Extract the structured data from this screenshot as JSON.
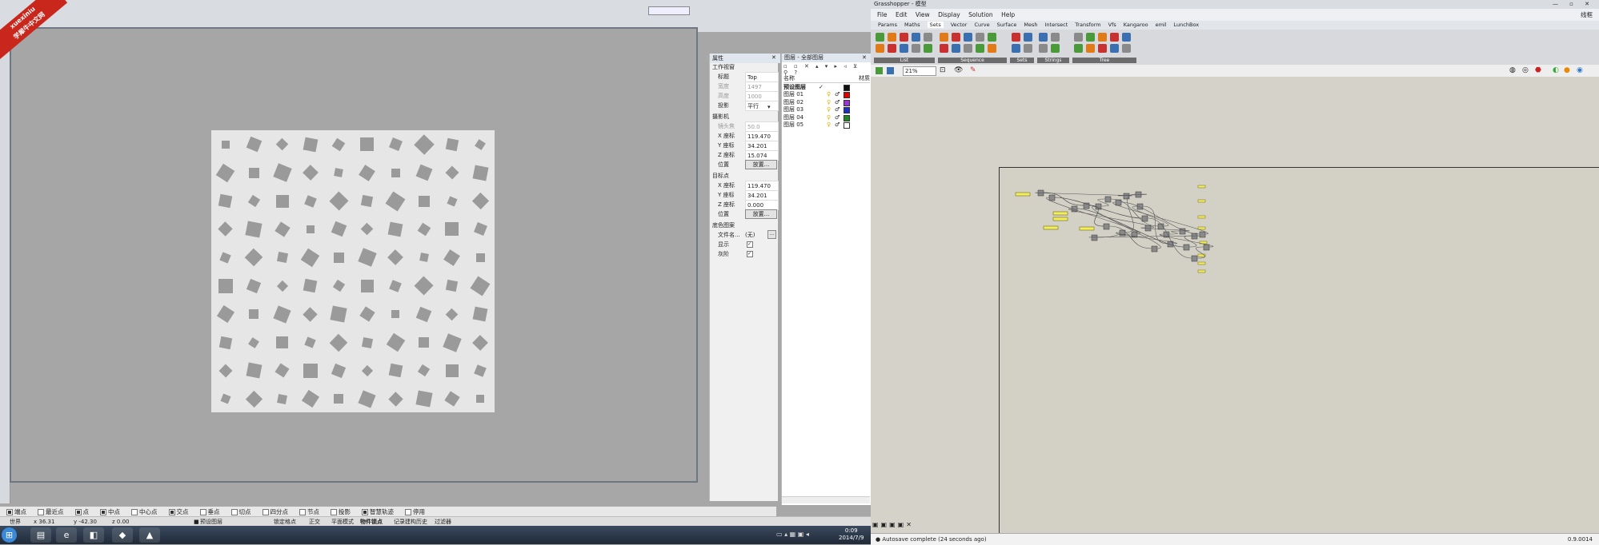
{
  "rhino": {
    "title": "",
    "subtitle": "",
    "menu": [
      "",
      ""
    ],
    "viewport_bg": "#a6a6a6"
  },
  "properties": {
    "header": "属性",
    "section_view": "工作视窗",
    "title_label": "标题",
    "title_value": "Top",
    "width_label": "宽度",
    "width_value": "1497",
    "height_label": "高度",
    "height_value": "1000",
    "projection_label": "投影",
    "projection_value": "平行",
    "section_camera": "摄影机",
    "lens_label": "镜头焦",
    "lens_value": "50.0",
    "cam_x_label": "X 座标",
    "cam_x_value": "119.470",
    "cam_y_label": "Y 座标",
    "cam_y_value": "34.201",
    "cam_z_label": "Z 座标",
    "cam_z_value": "15.074",
    "cam_pos_label": "位置",
    "place_button": "放置...",
    "section_target": "目标点",
    "tgt_x_label": "X 座标",
    "tgt_x_value": "119.470",
    "tgt_y_label": "Y 座标",
    "tgt_y_value": "34.201",
    "tgt_z_label": "Z 座标",
    "tgt_z_value": "0.000",
    "tgt_pos_label": "位置",
    "place_button2": "放置...",
    "section_bg": "底色图案",
    "file_label": "文件名...",
    "file_value": "(无)",
    "show_label": "显示",
    "gray_label": "灰阶"
  },
  "layers": {
    "header": "图层 - 全部图层",
    "col_name": "名称",
    "col_material": "材质",
    "rows": [
      {
        "name": "预设图层",
        "color": "#111111"
      },
      {
        "name": "图层 01",
        "color": "#e00000"
      },
      {
        "name": "图层 02",
        "color": "#9b35d6"
      },
      {
        "name": "图层 03",
        "color": "#1e2fd0"
      },
      {
        "name": "图层 04",
        "color": "#1d8a1d"
      },
      {
        "name": "图层 05",
        "color": "#ffffff"
      }
    ]
  },
  "osnap": {
    "items": [
      "端点",
      "最近点",
      "点",
      "中点",
      "中心点",
      "交点",
      "垂点",
      "切点",
      "四分点",
      "节点",
      "投影",
      "智慧轨迹",
      "停用"
    ]
  },
  "status": {
    "world": "世界",
    "x": "x 36.31",
    "y": "y -42.30",
    "z": "z 0.00",
    "layer": "预设图层",
    "grid_snap": "锁定格点",
    "ortho": "正交",
    "planar": "平面模式",
    "object_snap": "物件锁点",
    "record": "记录建构历史",
    "filter": "过滤器"
  },
  "taskbar": {
    "time": "0:09",
    "date": "2014/7/9"
  },
  "grasshopper": {
    "title": "Grasshopper - 模型",
    "menu": [
      "File",
      "Edit",
      "View",
      "Display",
      "Solution",
      "Help"
    ],
    "tabs": [
      "Params",
      "Maths",
      "Sets",
      "Vector",
      "Curve",
      "Surface",
      "Mesh",
      "Intersect",
      "Transform",
      "Vfs",
      "Kangaroo",
      "emil",
      "LunchBox"
    ],
    "ribbon_groups": [
      "List",
      "Sequence",
      "Sets",
      "Strings",
      "Tree"
    ],
    "zoom": "21%",
    "status_text": "Autosave complete (24 seconds ago)",
    "version": "0.9.0014",
    "right_label": "线框"
  },
  "watermark": {
    "line1": "xuexiniu",
    "line2": "学犀牛中文网"
  }
}
